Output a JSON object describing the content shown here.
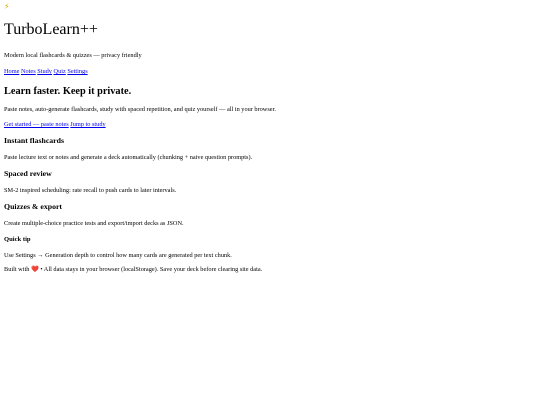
{
  "header": {
    "logo_glyph": "⚡",
    "title": "TurboLearn++",
    "tagline": "Modern local flashcards & quizzes — privacy friendly"
  },
  "nav": {
    "home": "Home",
    "notes": "Notes",
    "study": "Study",
    "quiz": "Quiz",
    "settings": "Settings"
  },
  "hero": {
    "heading": "Learn faster. Keep it private.",
    "text": "Paste notes, auto-generate flashcards, study with spaced repetition, and quiz yourself — all in your browser.",
    "cta_primary": "Get started — paste notes",
    "cta_secondary": "Jump to study"
  },
  "features": [
    {
      "heading": "Instant flashcards",
      "text": "Paste lecture text or notes and generate a deck automatically (chunking + naive question prompts)."
    },
    {
      "heading": "Spaced review",
      "text": "SM-2 inspired scheduling: rate recall to push cards to later intervals."
    },
    {
      "heading": "Quizzes & export",
      "text": "Create multiple-choice practice tests and export/import decks as JSON."
    }
  ],
  "tip": {
    "heading": "Quick tip",
    "text": "Use Settings → Generation depth to control how many cards are generated per text chunk."
  },
  "footer": {
    "prefix": "Built with",
    "heart_glyph": "❤️",
    "text": "• All data stays in your browser (localStorage). Save your deck before clearing site data."
  }
}
